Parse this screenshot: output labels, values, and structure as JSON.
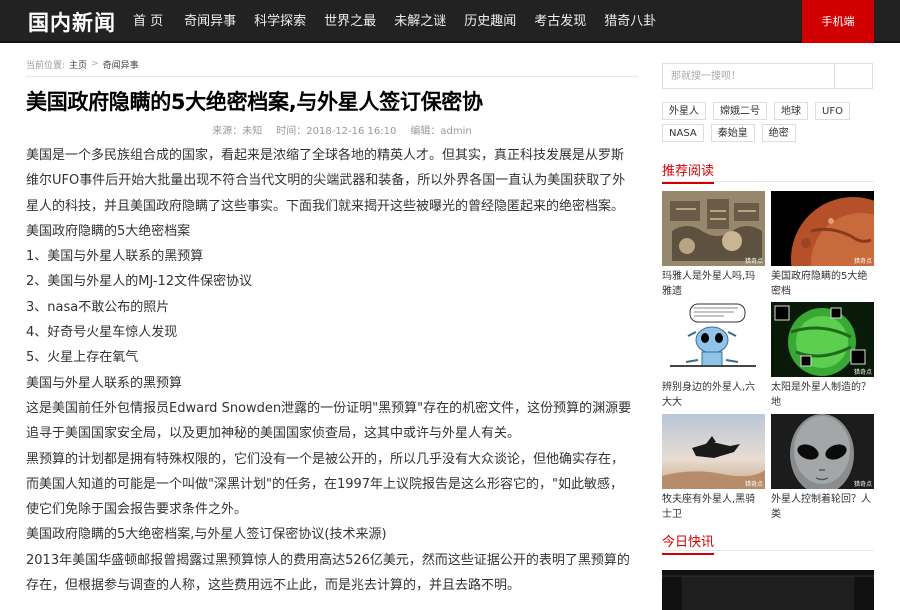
{
  "site": {
    "logo": "国内新闻"
  },
  "nav": {
    "items": [
      "首 页",
      "奇闻异事",
      "科学探索",
      "世界之最",
      "未解之谜",
      "历史趣闻",
      "考古发现",
      "猎奇八卦"
    ],
    "mobile_button": "手机端"
  },
  "breadcrumb": {
    "prefix": "当前位置:",
    "home": "主页",
    "separator": ">",
    "category": "奇闻异事"
  },
  "article": {
    "title": "美国政府隐瞒的5大绝密档案,与外星人签订保密协",
    "source": "来源：未知",
    "time": "时间：2018-12-16 16:10",
    "editor": "编辑：admin",
    "paragraphs": [
      "美国是一个多民族组合成的国家，看起来是浓缩了全球各地的精英人才。但其实，真正科技发展是从罗斯维尔UFO事件后开始大批量出现不符合当代文明的尖端武器和装备，所以外界各国一直认为美国获取了外星人的科技，并且美国政府隐瞒了这些事实。下面我们就来揭开这些被曝光的曾经隐匿起来的绝密档案。",
      "美国政府隐瞒的5大绝密档案",
      "1、美国与外星人联系的黑预算",
      "2、美国与外星人的MJ-12文件保密协议",
      "3、nasa不敢公布的照片",
      "4、好奇号火星车惊人发现",
      "5、火星上存在氧气",
      "美国与外星人联系的黑预算",
      "这是美国前任外包情报员Edward Snowden泄露的一份证明\"黑预算\"存在的机密文件，这份预算的渊源要追寻于美国国家安全局，以及更加神秘的美国国家侦查局，这其中或许与外星人有关。",
      "黑预算的计划都是拥有特殊权限的，它们没有一个是被公开的，所以几乎没有大众谈论，但他确实存在，而美国人知道的可能是一个叫做\"深黑计划\"的任务，在1997年上议院报告是这么形容它的，\"如此敏感，使它们免除于国会报告要求条件之外。",
      "美国政府隐瞒的5大绝密档案,与外星人签订保密协议(技术来源)",
      "2013年美国华盛顿邮报曾揭露过黑预算惊人的费用高达526亿美元，然而这些证据公开的表明了黑预算的存在，但根据参与调查的人称，这些费用远不止此，而是兆去计算的，并且去路不明。"
    ]
  },
  "sidebar": {
    "search_placeholder": "那就搜一搜呗！",
    "tags": [
      "外星人",
      "嫦娥二号",
      "地球",
      "UFO",
      "NASA",
      "秦始皇",
      "绝密"
    ],
    "recommended_title": "推荐阅读",
    "recommended": [
      {
        "title": "玛雅人是外星人吗,玛雅遗",
        "image": "maya-carving"
      },
      {
        "title": "美国政府隐瞒的5大绝密档",
        "image": "mars-planet"
      },
      {
        "title": "辨别身边的外星人,六大大",
        "image": "cartoon-alien"
      },
      {
        "title": "太阳是外星人制造的？地",
        "image": "green-sun"
      },
      {
        "title": "牧夫座有外星人,黑骑士卫",
        "image": "black-knight-satellite"
      },
      {
        "title": "外星人控制着轮回？人类",
        "image": "grey-alien-face"
      }
    ],
    "watermark": "猎奇点",
    "today_title": "今日快讯"
  }
}
